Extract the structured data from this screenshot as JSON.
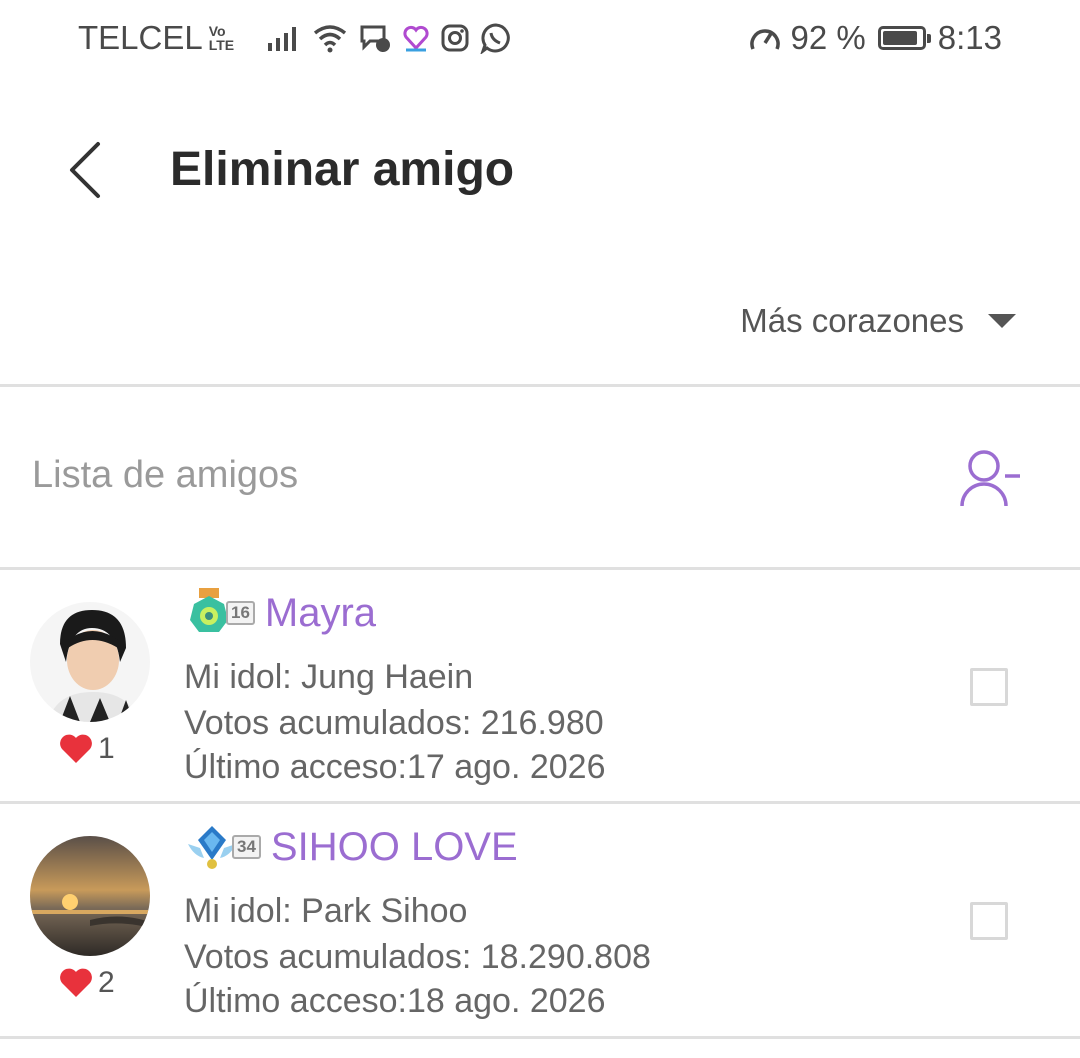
{
  "status_bar": {
    "carrier": "TELCEL",
    "volte_top": "Vo",
    "volte_bottom": "LTE",
    "battery": "92 %",
    "battery_level": 0.92,
    "time": "8:13"
  },
  "header": {
    "title": "Eliminar amigo"
  },
  "sort": {
    "label": "Más corazones"
  },
  "friends": {
    "section_label": "Lista de amigos",
    "items": [
      {
        "level": "16",
        "name": "Mayra",
        "idol": "Mi idol: Jung Haein",
        "votes": "Votos acumulados: 216.980",
        "last_access": "Último acceso:17 ago. 2026",
        "hearts": "1"
      },
      {
        "level": "34",
        "name": "SIHOO LOVE",
        "idol": "Mi idol: Park Sihoo",
        "votes": "Votos acumulados: 18.290.808",
        "last_access": "Último acceso:18 ago. 2026",
        "hearts": "2"
      }
    ]
  },
  "colors": {
    "accent": "#9b6dd1",
    "heart": "#e8323c",
    "divider": "#e0e0e0"
  }
}
